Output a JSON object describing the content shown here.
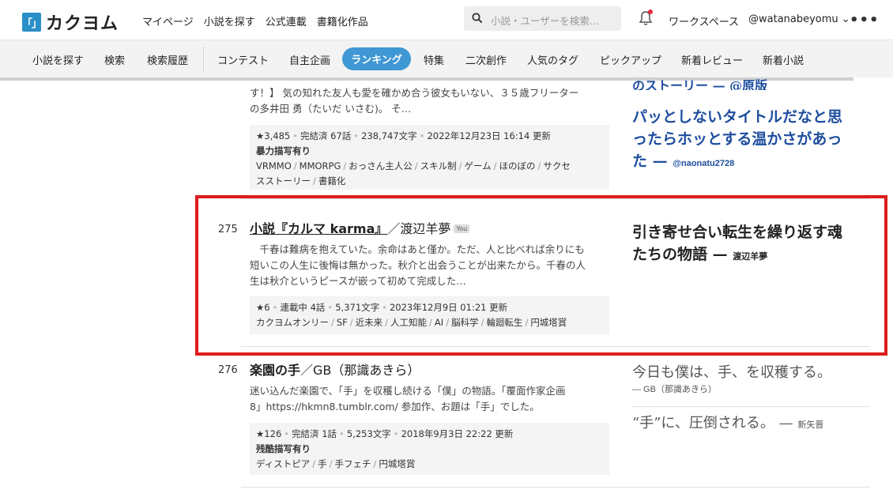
{
  "header": {
    "logo_mark": "「」",
    "logo_text": "カクヨム",
    "nav": [
      "マイページ",
      "小説を探す",
      "公式連載",
      "書籍化作品"
    ],
    "search_placeholder": "小説・ユーザーを検索…",
    "workspace": "ワークスペース",
    "user": "@watanabeyomu ⌄",
    "more": "•••"
  },
  "subnav": {
    "items": [
      "小説を探す",
      "検索",
      "検索履歴",
      "コンテスト",
      "自主企画",
      "特集",
      "二次創作",
      "人気のタグ",
      "ピックアップ",
      "新着レビュー",
      "新着小説"
    ],
    "active": "ランキング"
  },
  "entries": [
    {
      "intro_line1": "す！】 気の知れた友人も愛を確かめ合う彼女もいない、３５歳フリーター",
      "intro_line2": "の多井田 勇（たいだ いさむ)。 そ…",
      "stats": "★3,485",
      "status": "完結済 67話",
      "chars": "238,747文字",
      "updated": "2022年12月23日 16:14 更新",
      "warning": "暴力描写有り",
      "tags_line1": [
        "VRMMO",
        "MMORPG",
        "おっさん主人公",
        "スキル制",
        "ゲーム",
        "ほのぼの",
        "サクセ"
      ],
      "tags_line2": [
        "スストーリー",
        "書籍化"
      ],
      "review_top": "のストーリー — @原版",
      "review_line1": "パッとしないタイトルだなと思",
      "review_line2": "ったらホッとする温かさがあっ",
      "review_line3": "た —",
      "review_by": "@naonatu2728"
    },
    {
      "rank": "275",
      "title": "小説『カルマ karma』",
      "author": "／渡辺羊夢",
      "you": "You",
      "intro_line1": "　千春は難病を抱えていた。余命はあと僅か。ただ、人と比べれば余りにも",
      "intro_line2": "短いこの人生に後悔は無かった。秋介と出会うことが出来たから。千春の人",
      "intro_line3": "生は秋介というピースが嵌って初めて完成した…",
      "stats": "★6",
      "status": "連載中 4話",
      "chars": "5,371文字",
      "updated": "2023年12月9日 01:21 更新",
      "tags": [
        "カクヨムオンリー",
        "SF",
        "近未来",
        "人工知能",
        "AI",
        "脳科学",
        "輪廻転生",
        "円城塔賞"
      ],
      "review_line1": "引き寄せ合い転生を繰り返す魂",
      "review_line2": "たちの物語 —",
      "review_by": "渡辺羊夢"
    },
    {
      "rank": "276",
      "title": "楽園の手",
      "author": "／GB（那識あきら）",
      "intro_line1": "迷い込んだ楽園で、「手」を収穫し続ける「僕」の物語。「覆面作家企画",
      "intro_line2": "8」https://hkmn8.tumblr.com/ 参加作、お題は「手」でした。",
      "stats": "★126",
      "status": "完結済 1話",
      "chars": "5,253文字",
      "updated": "2018年9月3日 22:22 更新",
      "warning": "残酷描写有り",
      "tags": [
        "ディストピア",
        "手",
        "手フェチ",
        "円城塔賞"
      ],
      "review1": "今日も僕は、手、を収穫する。",
      "review1_by": "— GB（那識あきら）",
      "review2": "“手”に、圧倒される。 —",
      "review2_by": "新矢晋"
    }
  ]
}
